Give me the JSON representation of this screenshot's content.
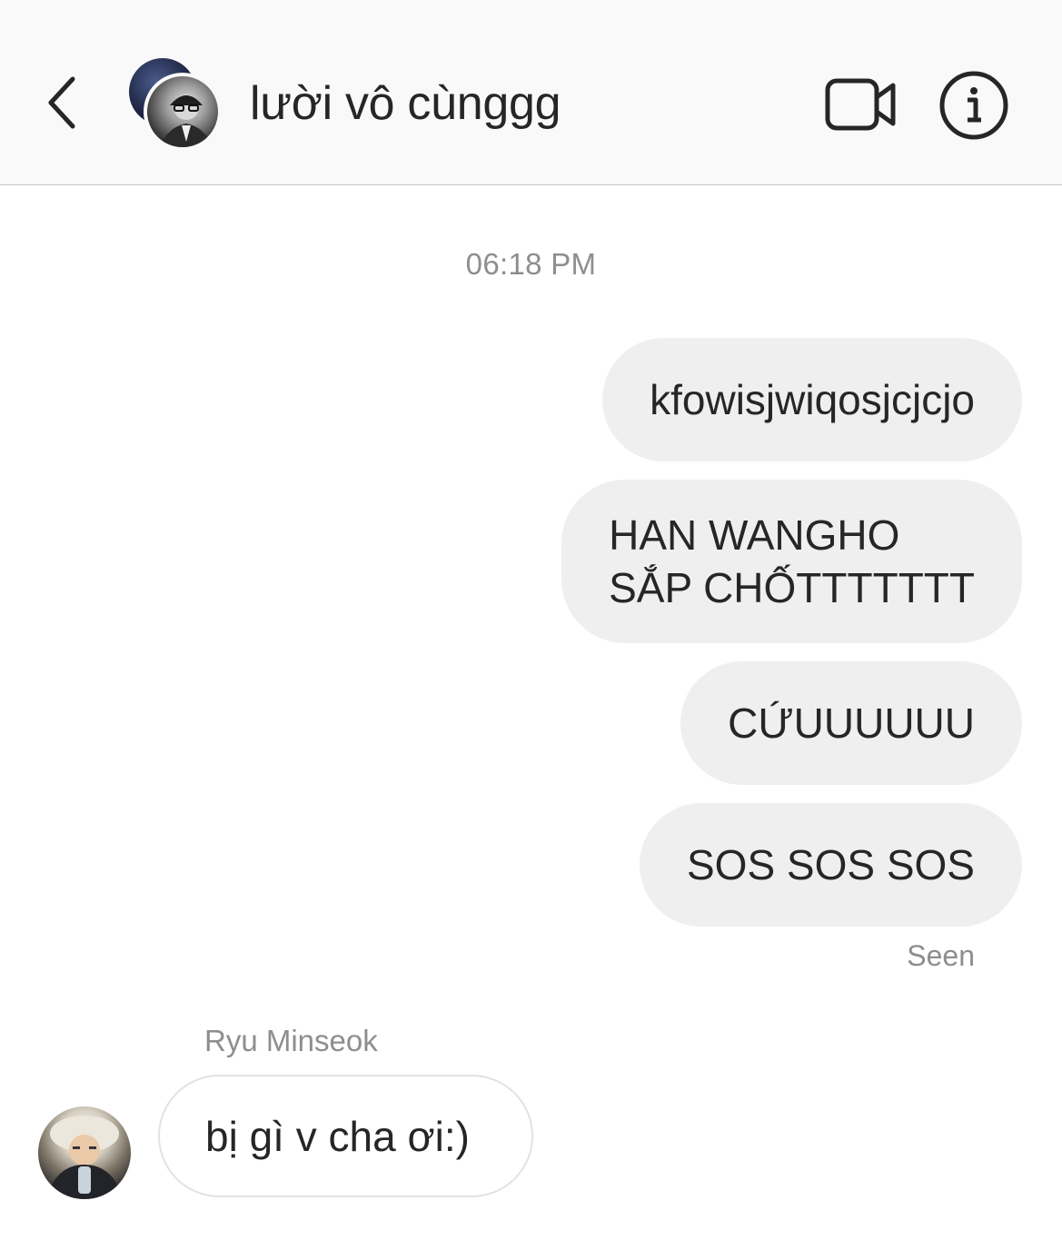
{
  "header": {
    "title": "lười vô cùnggg"
  },
  "thread": {
    "timestamp": "06:18 PM",
    "outgoing_messages": [
      {
        "text": "kfowisjwiqosjcjcjo"
      },
      {
        "line1": "HAN WANGHO",
        "line2": "SẮP CHỐTTTTTTT"
      },
      {
        "text": "CỨUUUUUU"
      },
      {
        "text": "SOS SOS SOS"
      }
    ],
    "seen_label": "Seen",
    "incoming": {
      "sender_name": "Ryu Minseok",
      "text": "bị gì v cha ơi:)"
    }
  },
  "colors": {
    "outgoing_bubble": "#efefef",
    "incoming_border": "#e2e2e2",
    "muted_text": "#8e8e8e",
    "primary_text": "#262626"
  },
  "icons": {
    "back": "chevron-left-icon",
    "video": "video-camera-icon",
    "info": "info-icon"
  }
}
